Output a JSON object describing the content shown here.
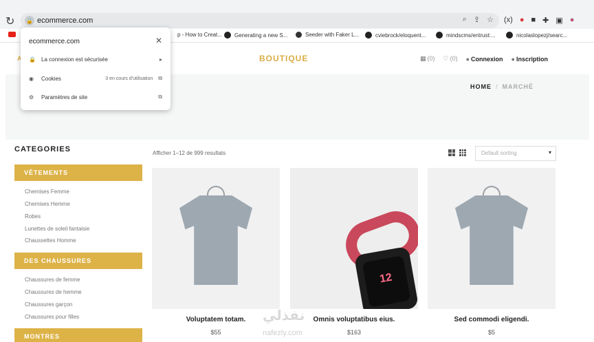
{
  "browser": {
    "url": "ecommerce.com",
    "bookmarks": [
      {
        "label": "p - How to Creat..."
      },
      {
        "label": "Generating a new S..."
      },
      {
        "label": "Seeder with Faker L..."
      },
      {
        "label": "cviebrock/eloquent..."
      },
      {
        "label": "mindscms/entrust:..."
      },
      {
        "label": "nicolaslopezj/searc..."
      }
    ],
    "ext_badge": "(x)"
  },
  "popup": {
    "title": "ecommerce.com",
    "rows": [
      {
        "label": "La connexion est sécurisée",
        "extra": ""
      },
      {
        "label": "Cookies",
        "extra": "3 en cours d'utilisation"
      },
      {
        "label": "Paramètres de site",
        "extra": ""
      }
    ]
  },
  "header": {
    "left_initial": "A",
    "logo": "BOUTIQUE",
    "compare_count": "(0)",
    "wishlist_count": "(0)",
    "login": "Connexion",
    "register": "Inscription"
  },
  "breadcrumb": {
    "home": "HOME",
    "separator": "/",
    "current": "MARCHÉ"
  },
  "sidebar": {
    "title": "CATEGORIES",
    "groups": [
      {
        "title": "VÊTEMENTS",
        "items": [
          "Chemises Femme",
          "Chemises Hemme",
          "Robes",
          "Lunettes de soleil fantaisie",
          "Chaussettes Homme"
        ]
      },
      {
        "title": "DES CHAUSSURES",
        "items": [
          "Chaussures de femme",
          "Chaussures de hemme",
          "Chaussures garçon",
          "Chaussures pour filles"
        ]
      },
      {
        "title": "MONTRES",
        "items": []
      }
    ]
  },
  "shop": {
    "result_count": "Afficher 1–12 de 999 resultats",
    "sort_placeholder": "Default sorting",
    "products": [
      {
        "name": "Voluptatem totam.",
        "price": "$55"
      },
      {
        "name": "Omnis voluptatibus eius.",
        "price": "$163"
      },
      {
        "name": "Sed commodi eligendi.",
        "price": "$5"
      }
    ]
  },
  "watermark": {
    "arabic": "نفذلي",
    "latin": "nafezly.com"
  },
  "colors": {
    "accent": "#ddb348",
    "chrome": "#f1f3f4"
  }
}
